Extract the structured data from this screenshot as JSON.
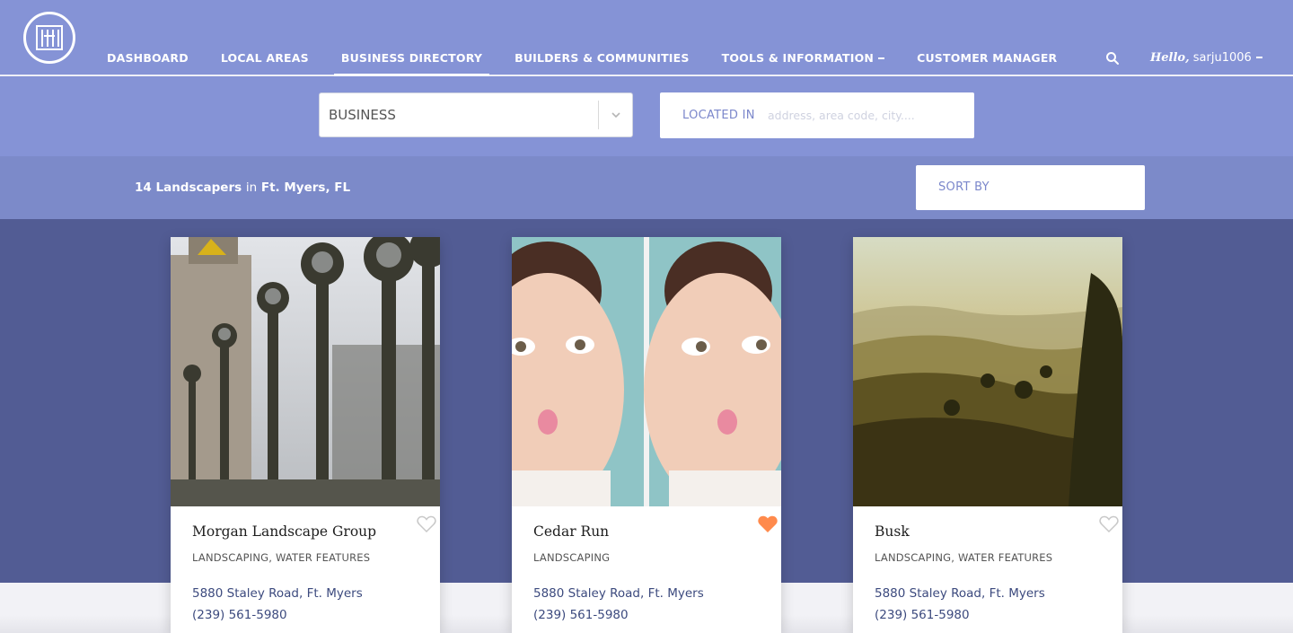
{
  "header": {
    "nav": [
      {
        "label": "DASHBOARD",
        "active": false
      },
      {
        "label": "LOCAL AREAS",
        "active": false
      },
      {
        "label": "BUSINESS DIRECTORY",
        "active": true
      },
      {
        "label": "BUILDERS & COMMUNITIES",
        "active": false
      },
      {
        "label": "TOOLS & INFORMATION",
        "active": false,
        "dropdown": true
      },
      {
        "label": "CUSTOMER MANAGER",
        "active": false
      }
    ],
    "greeting": "Hello,",
    "username": "sarju1006"
  },
  "search": {
    "category_value": "BUSINESS",
    "location_label": "LOCATED IN",
    "location_placeholder": "address, area code, city...."
  },
  "results": {
    "count_text": "14 Landscapers",
    "in_text": "in",
    "location_text": "Ft. Myers, FL",
    "sort_label": "SORT BY"
  },
  "listings": [
    {
      "name": "Morgan Landscape Group",
      "categories": "LANDSCAPING, WATER FEATURES",
      "address": "5880 Staley Road, Ft. Myers",
      "phone": "(239) 561-5980",
      "favorited": false
    },
    {
      "name": "Cedar Run",
      "categories": "LANDSCAPING",
      "address": "5880 Staley Road, Ft. Myers",
      "phone": "(239) 561-5980",
      "favorited": true
    },
    {
      "name": "Busk",
      "categories": "LANDSCAPING, WATER FEATURES",
      "address": "5880 Staley Road, Ft. Myers",
      "phone": "(239) 561-5980",
      "favorited": false
    }
  ],
  "colors": {
    "header_bg": "#8593d6",
    "results_bg": "#7c8ac9",
    "listings_bg": "#525c94",
    "favorite": "#ff8a4c",
    "heart_outline": "#c8c8c8",
    "text_link": "#3c4a7e"
  },
  "icons": {
    "logo": "building-logo-icon",
    "search": "search-icon",
    "select_arrow": "chevron-down-icon",
    "favorite": "heart-icon"
  }
}
